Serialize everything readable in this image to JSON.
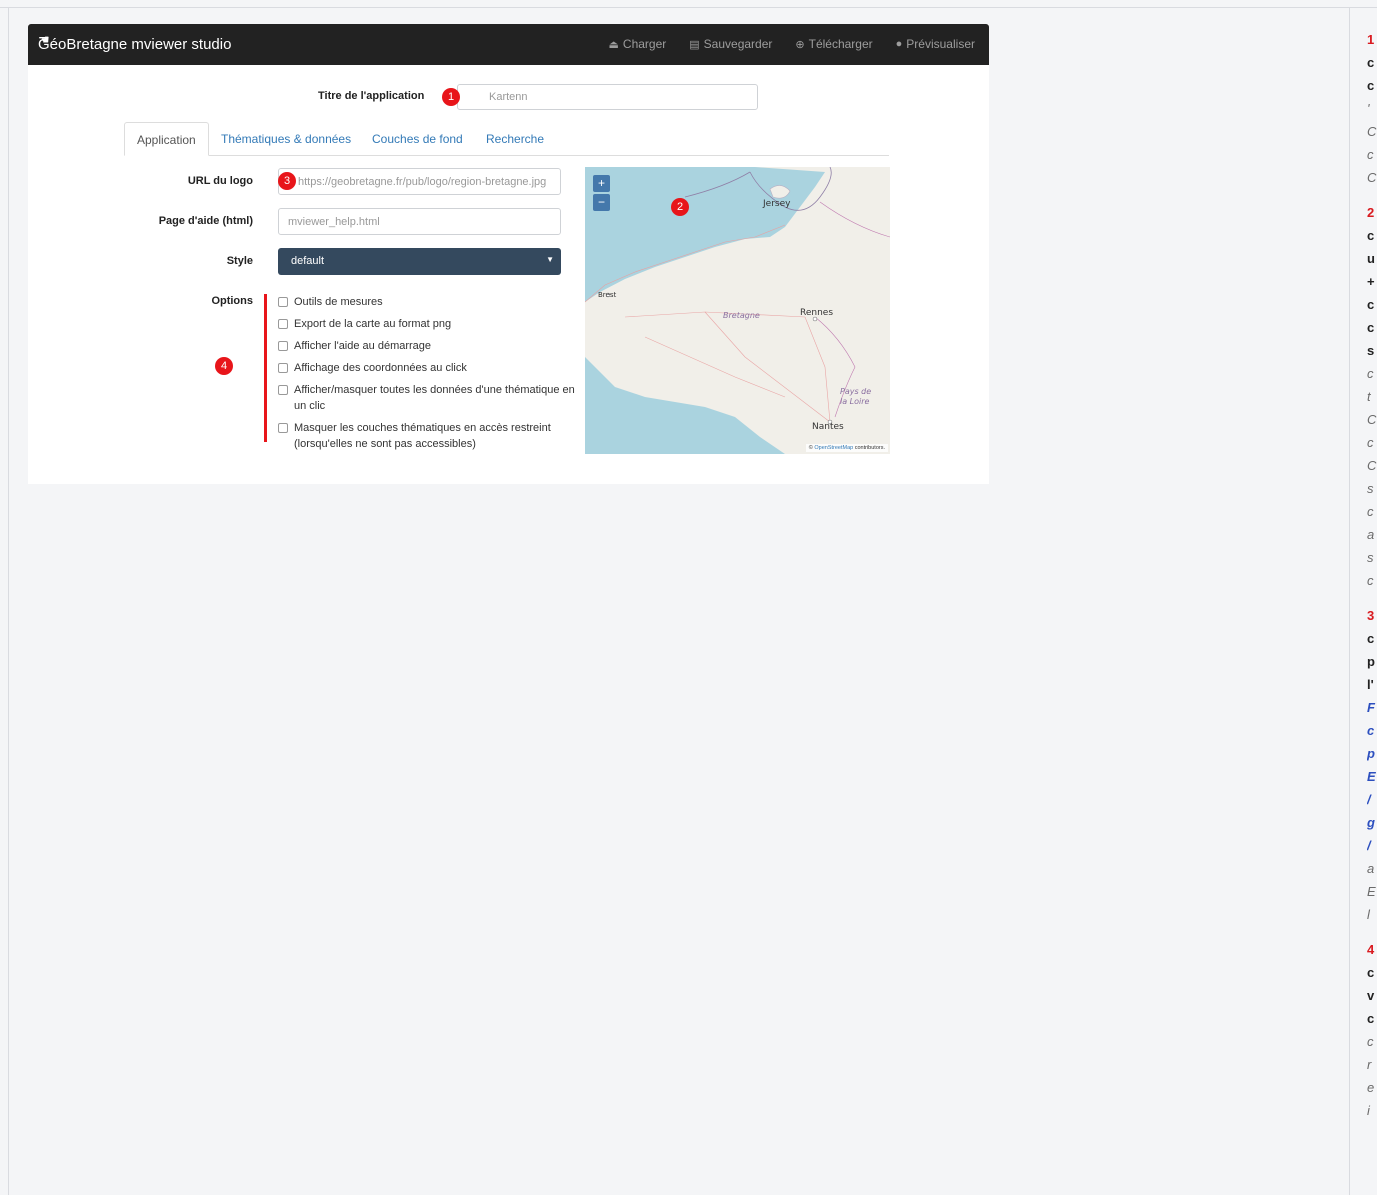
{
  "app": {
    "brand": "GéoBretagne mviewer studio",
    "nav": [
      {
        "icon": "upload-icon",
        "glyph": "⏏",
        "label": "Charger"
      },
      {
        "icon": "save-icon",
        "glyph": "💾",
        "label": "Sauvegarder"
      },
      {
        "icon": "download-icon",
        "glyph": "⊕",
        "label": "Télécharger"
      },
      {
        "icon": "globe-icon",
        "glyph": "●",
        "label": "Prévisualiser"
      }
    ],
    "title_label": "Titre de l'application",
    "title_placeholder": "Kartenn",
    "tabs": [
      "Application",
      "Thématiques & données",
      "Couches de fond",
      "Recherche"
    ],
    "active_tab": "Application",
    "logo_label": "URL du logo",
    "logo_placeholder": "https://geobretagne.fr/pub/logo/region-bretagne.jpg",
    "help_label": "Page d'aide (html)",
    "help_placeholder": "mviewer_help.html",
    "style_label": "Style",
    "style_value": "default",
    "options_label": "Options",
    "options": [
      "Outils de mesures",
      "Export de la carte au format png",
      "Afficher l'aide au démarrage",
      "Affichage des coordonnées au click",
      "Afficher/masquer toutes les données d'une thématique en un clic",
      "Masquer les couches thématiques en accès restreint (lorsqu'elles ne sont pas accessibles)"
    ],
    "map": {
      "zoom_in": "+",
      "zoom_out": "−",
      "places": [
        "Jersey",
        "Brest",
        "Bretagne",
        "Rennes",
        "Pays de la Loire",
        "Nantes"
      ],
      "attribution_prefix": "©",
      "attribution_link": "OpenStreetMap",
      "attribution_suffix": "contributors."
    }
  },
  "markers": [
    "1",
    "2",
    "3",
    "4"
  ],
  "right_column": [
    "1",
    "c",
    "c",
    "'",
    "C",
    "c",
    "C",
    "2",
    "c",
    "u",
    "+",
    "c",
    "c",
    "s",
    "c",
    "t",
    "C",
    "c",
    "C",
    "s",
    "c",
    "a",
    "s",
    "c",
    "3",
    "c",
    "p",
    "l'",
    "F",
    "c",
    "p",
    "E",
    "/",
    "g",
    "/",
    "a",
    "E",
    "l",
    "4",
    "c",
    "v",
    "c",
    "c",
    "r",
    "e",
    "i"
  ],
  "colors": {
    "navbar": "#222222",
    "marker": "#e8151a",
    "link": "#337ab7",
    "select": "#34495e",
    "map_water": "#aad3df"
  }
}
